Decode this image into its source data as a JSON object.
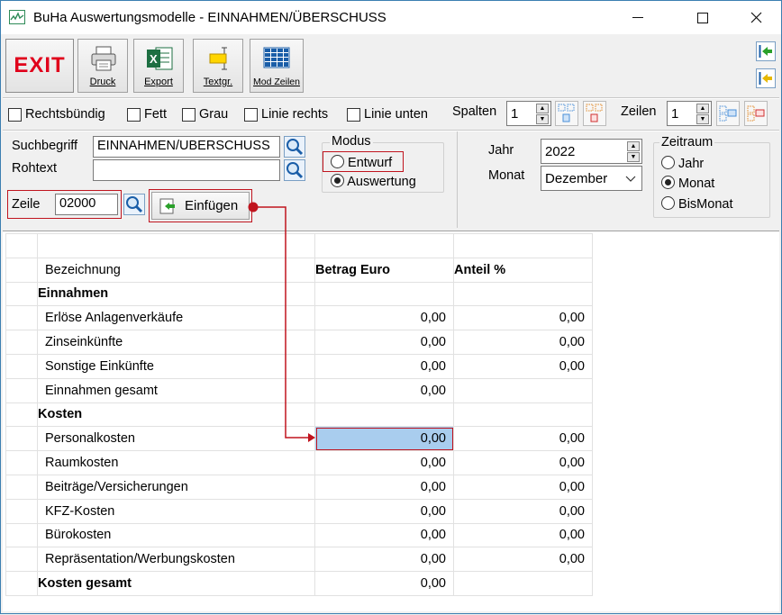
{
  "window": {
    "title": "BuHa Auswertungsmodelle - EINNAHMEN/ÜBERSCHUSS",
    "minimize": "—",
    "maximize": "☐",
    "close": "✕"
  },
  "toolbar": {
    "exit_label": "EXIT",
    "buttons": [
      {
        "label": "Druck",
        "icon": "printer-icon"
      },
      {
        "label": "Export",
        "icon": "excel-icon"
      },
      {
        "label": "Textgr.",
        "icon": "text-size-icon"
      },
      {
        "label": "Mod Zeilen",
        "icon": "grid-icon"
      }
    ]
  },
  "format": {
    "rechtsbuendig": "Rechtsbündig",
    "fett": "Fett",
    "grau": "Grau",
    "linie_rechts": "Linie rechts",
    "linie_unten": "Linie unten",
    "spalten_label": "Spalten",
    "spalten_value": "1",
    "zeilen_label": "Zeilen",
    "zeilen_value": "1"
  },
  "search": {
    "suchbegriff_label": "Suchbegriff",
    "suchbegriff_value": "EINNAHMEN/UBERSCHUSS",
    "rohtext_label": "Rohtext",
    "rohtext_value": "",
    "zeile_label": "Zeile",
    "zeile_value": "02000",
    "einfuegen_label": "Einfügen"
  },
  "modus": {
    "title": "Modus",
    "entwurf": "Entwurf",
    "auswertung": "Auswertung",
    "selected": "Auswertung"
  },
  "period": {
    "jahr_label": "Jahr",
    "jahr_value": "2022",
    "monat_label": "Monat",
    "monat_value": "Dezember"
  },
  "zeitraum": {
    "title": "Zeitraum",
    "jahr": "Jahr",
    "monat": "Monat",
    "bismonat": "BisMonat",
    "selected": "Monat"
  },
  "grid": {
    "header": {
      "bezeichnung": "Bezeichnung",
      "betrag": "Betrag Euro",
      "anteil": "Anteil %"
    },
    "rows": [
      {
        "type": "group",
        "label": "Einnahmen",
        "betrag": "",
        "anteil": ""
      },
      {
        "type": "item",
        "label": "Erlöse Anlagenverkäufe",
        "betrag": "0,00",
        "anteil": "0,00"
      },
      {
        "type": "item",
        "label": "Zinseinkünfte",
        "betrag": "0,00",
        "anteil": "0,00"
      },
      {
        "type": "item",
        "label": "Sonstige Einkünfte",
        "betrag": "0,00",
        "anteil": "0,00"
      },
      {
        "type": "item",
        "label": "Einnahmen gesamt",
        "betrag": "0,00",
        "anteil": ""
      },
      {
        "type": "group",
        "label": "Kosten",
        "betrag": "",
        "anteil": ""
      },
      {
        "type": "item",
        "label": "Personalkosten",
        "betrag": "0,00",
        "anteil": "0,00",
        "selected": true
      },
      {
        "type": "item",
        "label": "Raumkosten",
        "betrag": "0,00",
        "anteil": "0,00"
      },
      {
        "type": "item",
        "label": "Beiträge/Versicherungen",
        "betrag": "0,00",
        "anteil": "0,00"
      },
      {
        "type": "item",
        "label": "KFZ-Kosten",
        "betrag": "0,00",
        "anteil": "0,00"
      },
      {
        "type": "item",
        "label": "Bürokosten",
        "betrag": "0,00",
        "anteil": "0,00"
      },
      {
        "type": "item",
        "label": "Repräsentation/Werbungskosten",
        "betrag": "0,00",
        "anteil": "0,00"
      },
      {
        "type": "group",
        "label": "Kosten gesamt",
        "betrag": "0,00",
        "anteil": ""
      }
    ]
  },
  "colors": {
    "accent_red": "#c0141e",
    "selected_cell": "#a9cdee",
    "exit_red": "#e0001b"
  }
}
